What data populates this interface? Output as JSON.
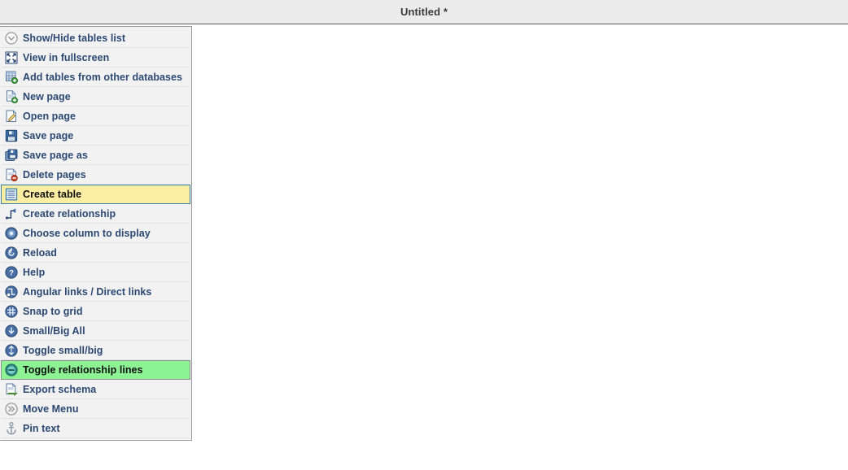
{
  "window": {
    "title": "Untitled *"
  },
  "colors": {
    "titlebar_bg": "#ececec",
    "title_text": "#3b3b3b",
    "panel_bg": "#f2f2f2",
    "panel_border": "#9a9a9a",
    "label_text": "#2c4873",
    "highlight_yellow": "#fbeda1",
    "highlight_yellow_border": "#3a7fa8",
    "highlight_green": "#8cf294",
    "canvas_bg": "#ffffff"
  },
  "menu": {
    "items": [
      {
        "label": "Show/Hide tables list",
        "icon": "circle-chevron-down-icon",
        "state": "normal"
      },
      {
        "label": "View in fullscreen",
        "icon": "fullscreen-arrows-icon",
        "state": "normal"
      },
      {
        "label": "Add tables from other databases",
        "icon": "table-add-icon",
        "state": "normal"
      },
      {
        "label": "New page",
        "icon": "page-add-icon",
        "state": "normal"
      },
      {
        "label": "Open page",
        "icon": "page-edit-icon",
        "state": "normal"
      },
      {
        "label": "Save page",
        "icon": "floppy-disk-icon",
        "state": "normal"
      },
      {
        "label": "Save page as",
        "icon": "floppy-disk-copy-icon",
        "state": "normal"
      },
      {
        "label": "Delete pages",
        "icon": "page-delete-icon",
        "state": "normal"
      },
      {
        "label": "Create table",
        "icon": "table-icon",
        "state": "highlight-yellow"
      },
      {
        "label": "Create relationship",
        "icon": "relationship-step-icon",
        "state": "normal"
      },
      {
        "label": "Choose column to display",
        "icon": "circle-dot-icon",
        "state": "normal"
      },
      {
        "label": "Reload",
        "icon": "circle-reload-icon",
        "state": "normal"
      },
      {
        "label": "Help",
        "icon": "circle-question-icon",
        "state": "normal"
      },
      {
        "label": "Angular links / Direct links",
        "icon": "circle-angular-icon",
        "state": "normal"
      },
      {
        "label": "Snap to grid",
        "icon": "circle-grid-icon",
        "state": "normal"
      },
      {
        "label": "Small/Big All",
        "icon": "circle-arrow-down-icon",
        "state": "normal"
      },
      {
        "label": "Toggle small/big",
        "icon": "circle-arrow-updown-icon",
        "state": "normal"
      },
      {
        "label": "Toggle relationship lines",
        "icon": "circle-minus-icon",
        "state": "highlight-green"
      },
      {
        "label": "Export schema",
        "icon": "page-export-icon",
        "state": "normal"
      },
      {
        "label": "Move Menu",
        "icon": "circle-double-chevron-icon",
        "state": "normal"
      },
      {
        "label": "Pin text",
        "icon": "anchor-pin-icon",
        "state": "normal"
      }
    ]
  }
}
